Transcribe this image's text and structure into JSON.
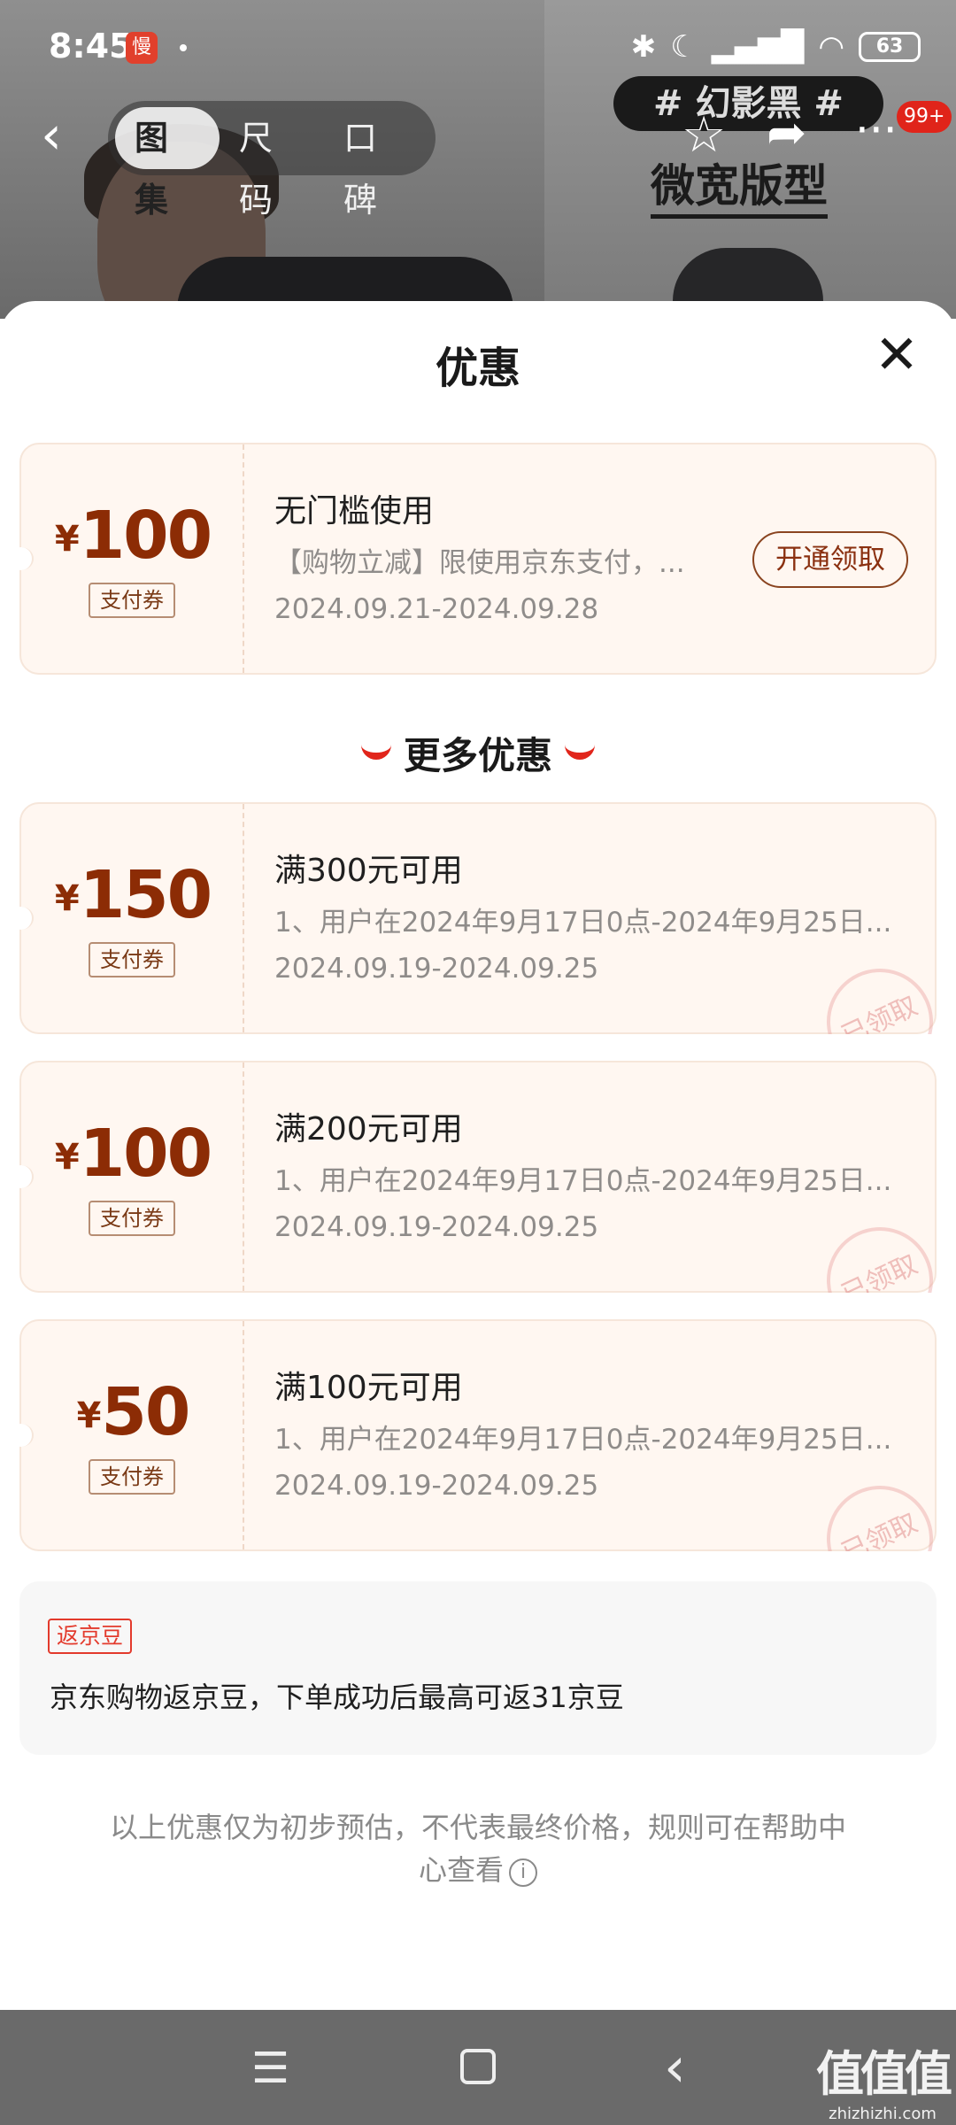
{
  "status_bar": {
    "time": "8:45",
    "app_badge": "慢",
    "battery": "63"
  },
  "top_nav": {
    "tabs": [
      "图集",
      "尺码",
      "口碑"
    ],
    "badge_count": "99+"
  },
  "product_banner": {
    "hashtag": "# 幻影黑 #",
    "fit_label": "微宽版型"
  },
  "sheet": {
    "title": "优惠",
    "coupon_main": {
      "currency": "¥",
      "amount": "100",
      "tag": "支付券",
      "title": "无门槛使用",
      "desc": "【购物立减】限使用京东支付，...",
      "date": "2024.09.21-2024.09.28",
      "button": "开通领取"
    },
    "more_header": "更多优惠",
    "coupons": [
      {
        "currency": "¥",
        "amount": "150",
        "tag": "支付券",
        "title": "满300元可用",
        "desc": "1、用户在2024年9月17日0点-2024年9月25日...",
        "date": "2024.09.19-2024.09.25",
        "stamp": "已领取"
      },
      {
        "currency": "¥",
        "amount": "100",
        "tag": "支付券",
        "title": "满200元可用",
        "desc": "1、用户在2024年9月17日0点-2024年9月25日...",
        "date": "2024.09.19-2024.09.25",
        "stamp": "已领取"
      },
      {
        "currency": "¥",
        "amount": "50",
        "tag": "支付券",
        "title": "满100元可用",
        "desc": "1、用户在2024年9月17日0点-2024年9月25日...",
        "date": "2024.09.19-2024.09.25",
        "stamp": "已领取"
      }
    ],
    "bean": {
      "tag": "返京豆",
      "text": "京东购物返京豆，下单成功后最高可返31京豆"
    },
    "disclaimer": "以上优惠仅为初步预估，不代表最终价格，规则可在帮助中心查看"
  },
  "watermark": {
    "big": "值值值",
    "small": "zhizhizhi.com"
  }
}
